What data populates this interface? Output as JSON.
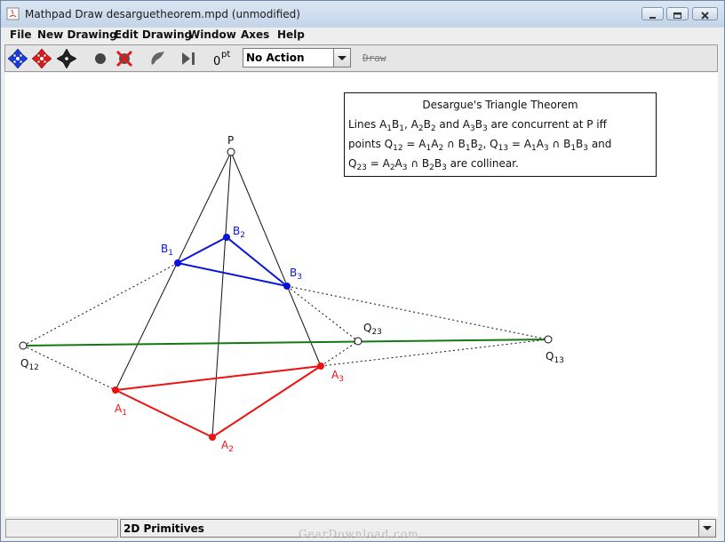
{
  "window": {
    "title": "Mathpad Draw desarguetheorem.mpd (unmodified)"
  },
  "menu": [
    "File",
    "New Drawing",
    "Edit Drawing",
    "Window",
    "Axes",
    "Help"
  ],
  "toolbar": {
    "tool_icons": [
      "blue-move-icon",
      "red-move-icon",
      "black-move-icon",
      "record-icon",
      "delete-icon",
      "pen-icon",
      "step-play-icon"
    ],
    "point_label": "0",
    "point_label_superscript": "pt",
    "action_selected": "No Action",
    "draw_label": "Draw"
  },
  "textbox": {
    "title": "Desargue's Triangle Theorem",
    "line1": {
      "a": "Lines A",
      "s1": "1",
      "b": "B",
      "s2": "1",
      "c": ", A",
      "s3": "2",
      "d": "B",
      "s4": "2",
      "e": " and A",
      "s5": "3",
      "f": "B",
      "s6": "3",
      "g": " are concurrent at P iff"
    },
    "line2": {
      "a": "points Q",
      "s1": "12",
      "b": " = A",
      "s2": "1",
      "c": "A",
      "s3": "2",
      "d": " ∩ B",
      "s4": "1",
      "e": "B",
      "s5": "2",
      "f": ", Q",
      "s6": "13",
      "g": " = A",
      "s7": "1",
      "h": "A",
      "s8": "3",
      "i": " ∩ B",
      "s9": "1",
      "j": "B",
      "s10": "3",
      "k": " and"
    },
    "line3": {
      "a": "Q",
      "s1": "23",
      "b": " = A",
      "s2": "2",
      "c": "A",
      "s3": "3",
      "d": " ∩ B",
      "s4": "2",
      "e": "B",
      "s5": "3",
      "f": " are collinear."
    }
  },
  "points": {
    "P": {
      "label": "P",
      "sub": ""
    },
    "A1": {
      "label": "A",
      "sub": "1"
    },
    "A2": {
      "label": "A",
      "sub": "2"
    },
    "A3": {
      "label": "A",
      "sub": "3"
    },
    "B1": {
      "label": "B",
      "sub": "1"
    },
    "B2": {
      "label": "B",
      "sub": "2"
    },
    "B3": {
      "label": "B",
      "sub": "3"
    },
    "Q12": {
      "label": "Q",
      "sub": "12"
    },
    "Q13": {
      "label": "Q",
      "sub": "13"
    },
    "Q23": {
      "label": "Q",
      "sub": "23"
    }
  },
  "colors": {
    "triangle_a": "#ee1111",
    "triangle_b": "#0a14d8",
    "collinear_line": "#127a12",
    "construction": "#111111"
  },
  "status": {
    "left_field": "",
    "mode_selected": "2D Primitives"
  },
  "watermark": "GearDownload.com"
}
